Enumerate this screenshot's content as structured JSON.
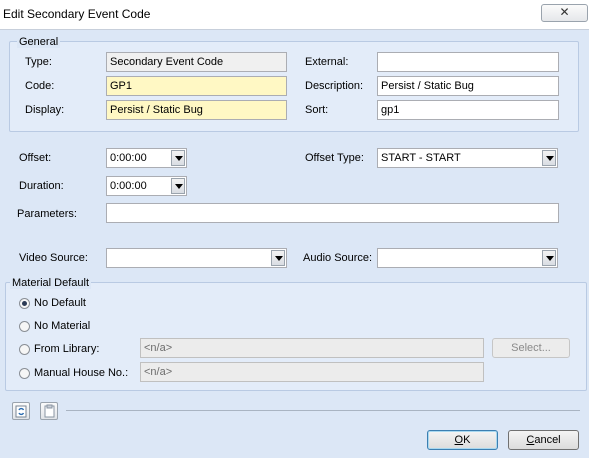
{
  "window": {
    "title": "Edit Secondary Event Code",
    "close_symbol": "✕"
  },
  "general": {
    "group_label": "General",
    "type_label": "Type:",
    "type_value": "Secondary Event Code",
    "code_label": "Code:",
    "code_value": "GP1",
    "display_label": "Display:",
    "display_value": "Persist / Static Bug",
    "external_label": "External:",
    "external_value": "",
    "description_label": "Description:",
    "description_value": "Persist / Static Bug",
    "sort_label": "Sort:",
    "sort_value": "gp1"
  },
  "timing": {
    "offset_label": "Offset:",
    "offset_value": "0:00:00",
    "duration_label": "Duration:",
    "duration_value": "0:00:00",
    "offset_type_label": "Offset Type:",
    "offset_type_value": "START - START",
    "parameters_label": "Parameters:",
    "parameters_value": ""
  },
  "sources": {
    "video_label": "Video Source:",
    "video_value": "",
    "audio_label": "Audio Source:",
    "audio_value": ""
  },
  "material": {
    "group_label": "Material Default",
    "options": [
      {
        "label": "No Default",
        "selected": true
      },
      {
        "label": "No Material",
        "selected": false
      },
      {
        "label": "From Library:",
        "selected": false
      },
      {
        "label": "Manual House No.:",
        "selected": false
      }
    ],
    "library_value": "<n/a>",
    "house_value": "<n/a>",
    "select_button": "Select..."
  },
  "buttons": {
    "ok_rest": "K",
    "cancel_rest": "ancel",
    "ok_key": "O",
    "cancel_key": "C"
  },
  "icons": [
    "refresh-icon",
    "clipboard-icon",
    "close-icon",
    "dropdown-arrow-icon"
  ]
}
